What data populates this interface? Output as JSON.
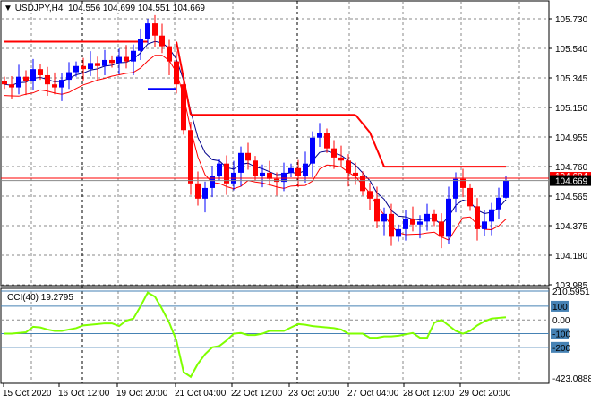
{
  "header": {
    "arrow": "▼",
    "symbol": "USDJPY,H4",
    "open": "104.556",
    "high": "104.699",
    "low": "104.551",
    "close": "104.669"
  },
  "price_axis": [
    "105.730",
    "105.540",
    "105.345",
    "105.150",
    "104.955",
    "104.760",
    "104.565",
    "104.375",
    "104.180",
    "103.985"
  ],
  "current_price": "104.669",
  "stop_price": "104.684",
  "cci": {
    "label": "CCI(40) 19.2795",
    "axis": [
      "210.5951",
      "100",
      "0.00",
      "-100",
      "-200",
      "-423.0888"
    ]
  },
  "time_axis": [
    "15 Oct 2020",
    "16 Oct 12:00",
    "19 Oct 20:00",
    "21 Oct 04:00",
    "22 Oct 12:00",
    "23 Oct 20:00",
    "27 Oct 04:00",
    "28 Oct 12:00",
    "29 Oct 20:00"
  ],
  "colors": {
    "bull": "#0000ff",
    "bear": "#ff0000",
    "cci": "#7fff00",
    "level": "#4682b4",
    "ma_blue": "#00008b",
    "ma_red": "#ff0000"
  },
  "chart_data": {
    "type": "candlestick",
    "symbol": "USDJPY",
    "timeframe": "H4",
    "last_bar": {
      "open": 104.556,
      "high": 104.699,
      "low": 104.551,
      "close": 104.669
    },
    "ylim": [
      103.985,
      105.73
    ],
    "close": [
      105.3,
      105.28,
      105.35,
      105.32,
      105.4,
      105.36,
      105.3,
      105.28,
      105.33,
      105.38,
      105.42,
      105.4,
      105.44,
      105.42,
      105.46,
      105.44,
      105.48,
      105.45,
      105.52,
      105.6,
      105.7,
      105.62,
      105.55,
      105.45,
      105.3,
      105.0,
      104.65,
      104.55,
      104.62,
      104.7,
      104.78,
      104.65,
      104.72,
      104.85,
      104.8,
      104.7,
      104.72,
      104.68,
      104.66,
      104.72,
      104.75,
      104.7,
      104.78,
      104.95,
      104.98,
      104.88,
      104.82,
      104.8,
      104.72,
      104.7,
      104.6,
      104.55,
      104.4,
      104.45,
      104.3,
      104.35,
      104.42,
      104.38,
      104.4,
      104.45,
      104.4,
      104.3,
      104.55,
      104.68,
      104.62,
      104.5,
      104.35,
      104.4,
      104.48,
      104.556,
      104.669
    ],
    "cci_values": [
      -100,
      -100,
      -95,
      -90,
      -50,
      -55,
      -70,
      -80,
      -80,
      -70,
      -60,
      -40,
      -35,
      -30,
      -25,
      -25,
      -45,
      -5,
      10,
      100,
      200,
      170,
      80,
      -20,
      -150,
      -380,
      -415,
      -320,
      -250,
      -200,
      -190,
      -150,
      -100,
      -95,
      -110,
      -110,
      -100,
      -80,
      -80,
      -80,
      -55,
      -30,
      -35,
      -45,
      -50,
      -55,
      -60,
      -70,
      -100,
      -100,
      -100,
      -130,
      -130,
      -120,
      -120,
      -115,
      -105,
      -95,
      -130,
      -130,
      -20,
      0,
      -40,
      -80,
      -100,
      -80,
      -40,
      -10,
      10,
      15,
      19.28
    ],
    "cci_ylim": [
      -423.0888,
      210.5951
    ],
    "cci_levels": [
      100,
      0,
      -100,
      -200
    ],
    "trailing_stop": [
      {
        "from": 0,
        "to": 20,
        "price": 105.58
      },
      {
        "from": 20,
        "to": 24,
        "price": 105.27,
        "color": "blue"
      },
      {
        "from": 26,
        "to": 49,
        "price": 105.1
      },
      {
        "from": 53,
        "to": 70,
        "price": 104.76
      }
    ]
  }
}
